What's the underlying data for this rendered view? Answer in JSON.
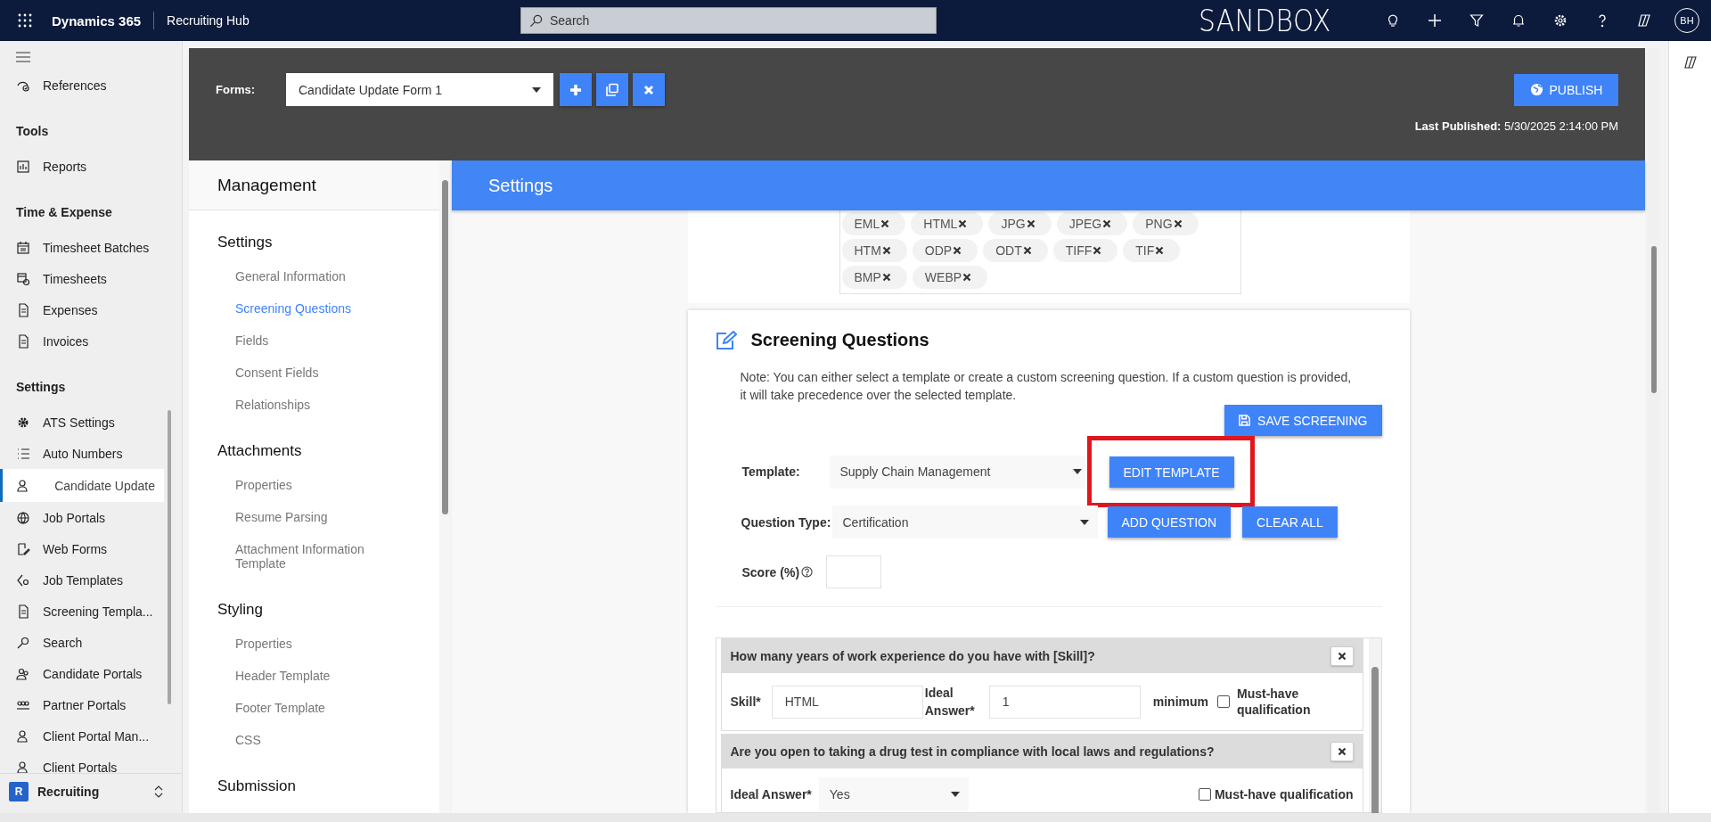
{
  "top_bar": {
    "app_name": "Dynamics 365",
    "area": "Recruiting Hub",
    "search": {
      "placeholder": "Search"
    },
    "environment": "SANDBOX",
    "avatar": "BH"
  },
  "nav": {
    "sections": [
      {
        "items": [
          {
            "label": "References",
            "selected": false
          }
        ]
      },
      {
        "title": "Tools",
        "items": [
          {
            "label": "Reports",
            "selected": false
          }
        ]
      },
      {
        "title": "Time & Expense",
        "items": [
          {
            "label": "Timesheet Batches",
            "selected": false
          },
          {
            "label": "Timesheets",
            "selected": false
          },
          {
            "label": "Expenses",
            "selected": false
          },
          {
            "label": "Invoices",
            "selected": false
          }
        ]
      },
      {
        "title": "Settings",
        "items": [
          {
            "label": "ATS Settings",
            "selected": false
          },
          {
            "label": "Auto Numbers",
            "selected": false
          },
          {
            "label": "Candidate Update",
            "selected": true
          },
          {
            "label": "Job Portals",
            "selected": false
          },
          {
            "label": "Web Forms",
            "selected": false
          },
          {
            "label": "Job Templates",
            "selected": false
          },
          {
            "label": "Screening Templa...",
            "selected": false
          },
          {
            "label": "Search",
            "selected": false
          },
          {
            "label": "Candidate Portals",
            "selected": false
          },
          {
            "label": "Partner Portals",
            "selected": false
          },
          {
            "label": "Client Portal Man...",
            "selected": false
          },
          {
            "label": "Client Portals",
            "selected": false
          }
        ]
      }
    ],
    "area_switcher": {
      "badge": "R",
      "label": "Recruiting"
    }
  },
  "forms_header": {
    "label": "Forms:",
    "form": "Candidate Update Form 1",
    "publish": "PUBLISH",
    "last_published_label": "Last Published:",
    "last_published": "5/30/2025 2:14:00 PM"
  },
  "management": {
    "title": "Management",
    "groups": [
      {
        "title": "Settings",
        "items": [
          {
            "label": "General Information",
            "selected": false
          },
          {
            "label": "Screening Questions",
            "selected": true
          },
          {
            "label": "Fields",
            "selected": false
          },
          {
            "label": "Consent Fields",
            "selected": false
          },
          {
            "label": "Relationships",
            "selected": false
          }
        ]
      },
      {
        "title": "Attachments",
        "items": [
          {
            "label": "Properties",
            "selected": false
          },
          {
            "label": "Resume Parsing",
            "selected": false
          },
          {
            "label": "Attachment Information Template",
            "selected": false
          }
        ]
      },
      {
        "title": "Styling",
        "items": [
          {
            "label": "Properties",
            "selected": false
          },
          {
            "label": "Header Template",
            "selected": false
          },
          {
            "label": "Footer Template",
            "selected": false
          },
          {
            "label": "CSS",
            "selected": false
          }
        ]
      },
      {
        "title": "Submission"
      }
    ]
  },
  "section_bar": {
    "title": "Settings"
  },
  "file_types": [
    "EML",
    "HTML",
    "JPG",
    "JPEG",
    "PNG",
    "HTM",
    "ODP",
    "ODT",
    "TIFF",
    "TIF",
    "BMP",
    "WEBP"
  ],
  "screening": {
    "title": "Screening Questions",
    "note": "Note: You can either select a template or create a custom screening question. If a custom question is provided, it will take precedence over the selected template.",
    "save_button": "SAVE SCREENING",
    "template_label": "Template:",
    "template": "Supply Chain Management",
    "edit_button": "EDIT TEMPLATE",
    "highlighted": true,
    "question_type_label": "Question Type:",
    "question_type": "Certification",
    "add_button": "ADD QUESTION",
    "clear_button": "CLEAR ALL",
    "score_label": "Score (%)",
    "questions": [
      {
        "kind": "range",
        "text": "How many years of work experience do you have with [Skill]?",
        "skill_label": "Skill*",
        "skill": "HTML",
        "answer_label": "Ideal Answer*",
        "answer": "1",
        "suffix": "minimum",
        "must_have_label": "Must-have qualification",
        "checked": false
      },
      {
        "kind": "choice",
        "text": "Are you open to taking a drug test in compliance with local laws and regulations?",
        "answer_label": "Ideal Answer*",
        "answer": "Yes",
        "must_have_label": "Must-have qualification",
        "checked": false
      }
    ]
  }
}
